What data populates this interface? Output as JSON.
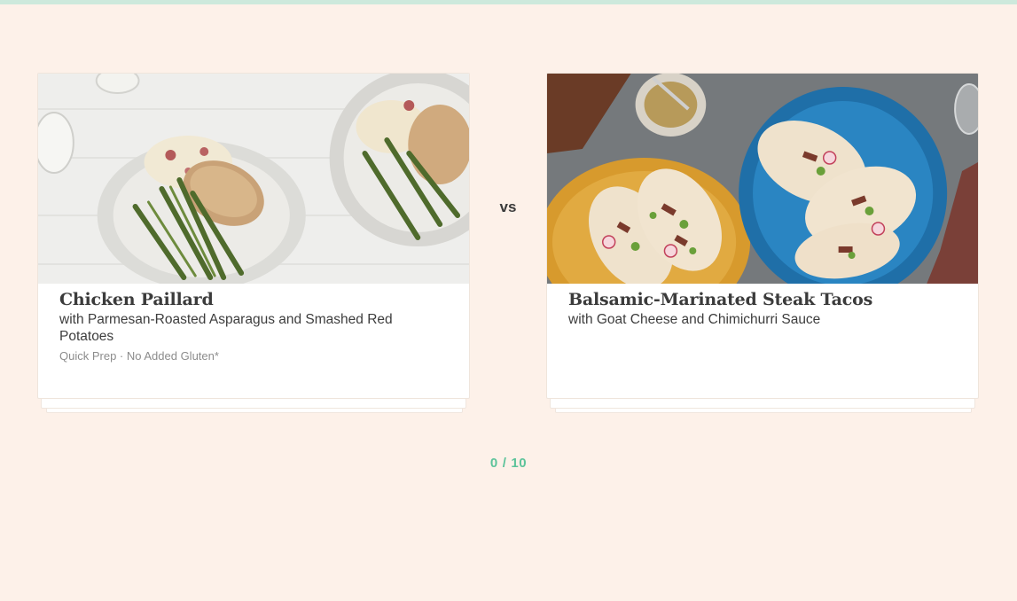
{
  "colors": {
    "background": "#fdf1e9",
    "accent_green": "#5cc39a",
    "top_bar": "#cde9dc"
  },
  "cards": [
    {
      "title": "Chicken Paillard",
      "subtitle": "with Parmesan-Roasted Asparagus and Smashed Red Potatoes",
      "tags": "Quick Prep · No Added Gluten*",
      "image_icon": "chicken-paillard-photo"
    },
    {
      "title": "Balsamic-Marinated Steak Tacos",
      "subtitle": "with Goat Cheese and Chimichurri Sauce",
      "tags": "",
      "image_icon": "steak-tacos-photo"
    }
  ],
  "versus_label": "vs",
  "progress": {
    "current": "0",
    "separator": "/",
    "total": "10"
  }
}
